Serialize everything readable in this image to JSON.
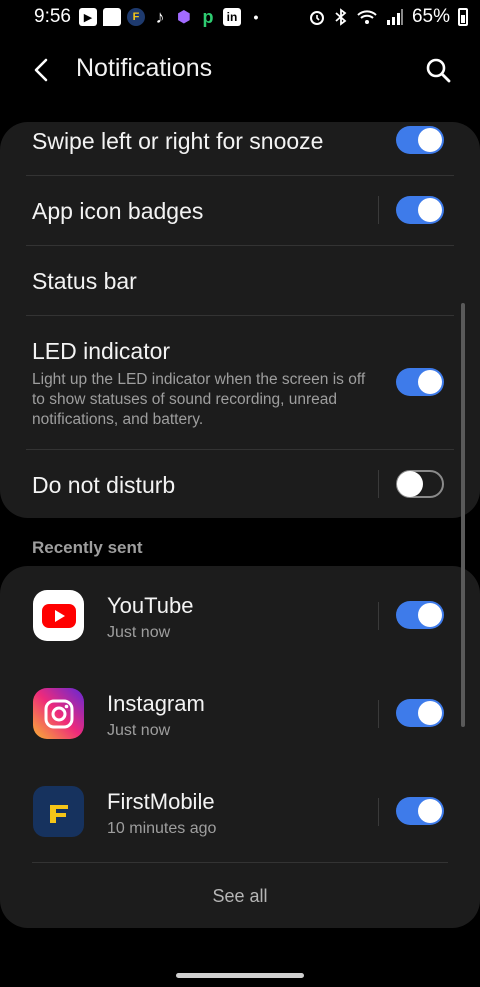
{
  "status": {
    "time": "9:56",
    "battery": "65%",
    "left_icons": [
      "youtube-icon",
      "chat-icon",
      "app-icon",
      "tiktok-icon",
      "app-icon",
      "p-icon",
      "linkedin-icon",
      "dot-icon"
    ],
    "right_icons": [
      "alarm-icon",
      "bluetooth-icon",
      "wifi-icon",
      "signal-icon"
    ]
  },
  "header": {
    "title": "Notifications"
  },
  "settings": {
    "swipe": {
      "label": "Swipe left or right for snooze",
      "on": true
    },
    "badges": {
      "label": "App icon badges",
      "on": true
    },
    "statusbar": {
      "label": "Status bar"
    },
    "led": {
      "label": "LED indicator",
      "desc": "Light up the LED indicator when the screen is off to show statuses of sound recording, unread notifications, and battery.",
      "on": true
    },
    "dnd": {
      "label": "Do not disturb",
      "on": false
    }
  },
  "recent": {
    "title": "Recently sent",
    "apps": [
      {
        "name": "YouTube",
        "time": "Just now",
        "on": true
      },
      {
        "name": "Instagram",
        "time": "Just now",
        "on": true
      },
      {
        "name": "FirstMobile",
        "time": "10 minutes ago",
        "on": true
      }
    ],
    "see_all": "See all"
  },
  "colors": {
    "accent": "#3e7bea",
    "card": "#1c1c1c",
    "background": "#000000"
  }
}
